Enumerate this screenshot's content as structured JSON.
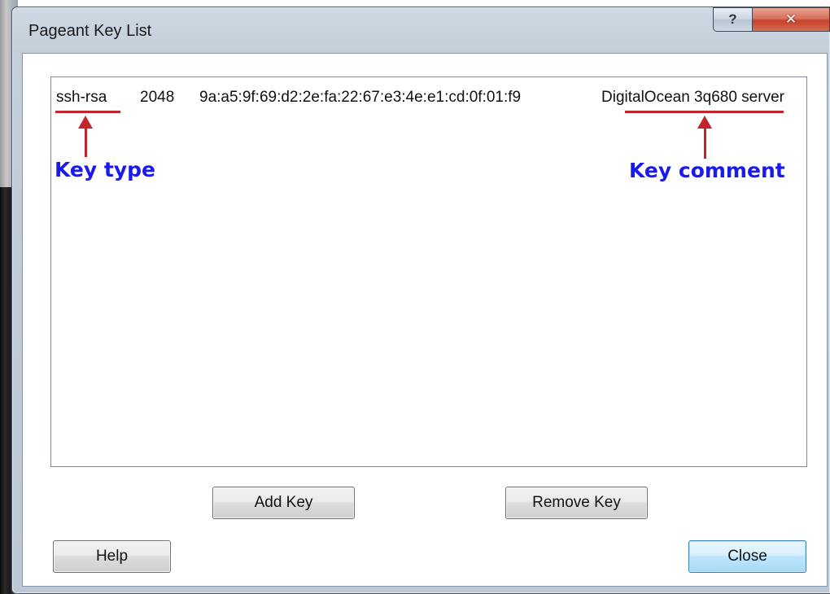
{
  "window": {
    "title": "Pageant Key List",
    "help_caption": "?",
    "close_caption": "✕"
  },
  "keys": [
    {
      "type": "ssh-rsa",
      "bits": "2048",
      "fingerprint": "9a:a5:9f:69:d2:2e:fa:22:67:e3:4e:e1:cd:0f:01:f9",
      "comment": "DigitalOcean 3q680 server"
    }
  ],
  "annotations": {
    "key_type_label": "Key type",
    "key_comment_label": "Key comment",
    "color_underline": "#c0252c",
    "color_label": "#1a1aee"
  },
  "buttons": {
    "add_key": "Add Key",
    "remove_key": "Remove Key",
    "help": "Help",
    "close": "Close"
  }
}
